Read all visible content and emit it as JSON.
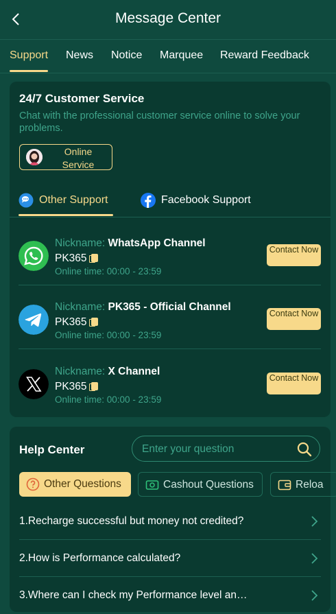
{
  "header": {
    "title": "Message Center"
  },
  "tabs": [
    {
      "label": "Support"
    },
    {
      "label": "News"
    },
    {
      "label": "Notice"
    },
    {
      "label": "Marquee"
    },
    {
      "label": "Reward Feedback"
    }
  ],
  "customer_service": {
    "title": "24/7 Customer Service",
    "subtitle": "Chat with the professional customer service online to solve your problems.",
    "online_button": "Online Service"
  },
  "support_tabs": [
    {
      "label": "Other Support",
      "icon": "chat-bubble-icon"
    },
    {
      "label": "Facebook Support",
      "icon": "facebook-icon"
    }
  ],
  "channels": [
    {
      "nickname_label": "Nickname:",
      "name": "WhatsApp Channel",
      "account": "PK365",
      "online_time": "Online time: 00:00 - 23:59",
      "contact_label": "Contact Now",
      "icon": "whatsapp-icon"
    },
    {
      "nickname_label": "Nickname:",
      "name": "PK365 - Official Channel",
      "account": "PK365",
      "online_time": "Online time: 00:00 - 23:59",
      "contact_label": "Contact Now",
      "icon": "telegram-icon"
    },
    {
      "nickname_label": "Nickname:",
      "name": "X Channel",
      "account": "PK365",
      "online_time": "Online time: 00:00 - 23:59",
      "contact_label": "Contact Now",
      "icon": "x-icon"
    }
  ],
  "help_center": {
    "title": "Help Center",
    "search_placeholder": "Enter your question",
    "question_tabs": [
      {
        "label": "Other Questions",
        "icon": "question-icon"
      },
      {
        "label": "Cashout Questions",
        "icon": "cash-icon"
      },
      {
        "label": "Reloa",
        "icon": "wallet-icon"
      }
    ],
    "questions": [
      "1.Recharge successful but money not credited?",
      "2.How is Performance calculated?",
      "3.Where can I check my Performance level an…"
    ]
  },
  "colors": {
    "background": "#0f4a3e",
    "card": "#0a3a30",
    "accent": "#f7d98a",
    "muted_text": "#3fa58b"
  }
}
